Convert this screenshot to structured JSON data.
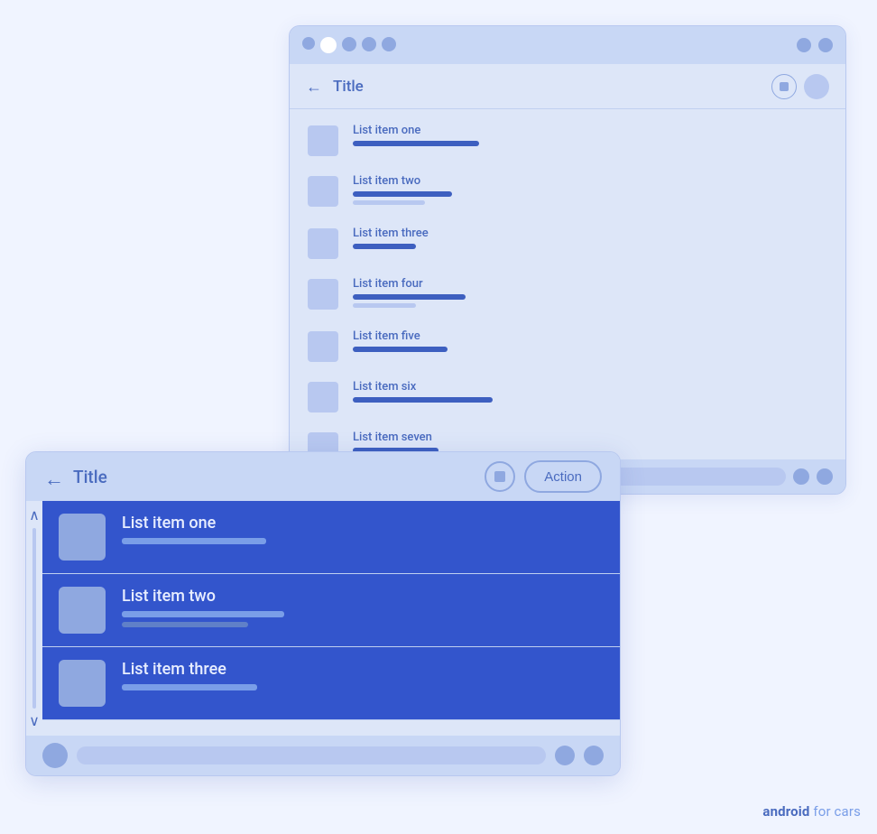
{
  "back_window": {
    "title": "Title",
    "list_items": [
      {
        "label": "List item one",
        "bar1_w": 140,
        "bar2_w": 0,
        "bar3_w": 0
      },
      {
        "label": "List item two",
        "bar1_w": 110,
        "bar2_w": 80,
        "bar3_w": 0
      },
      {
        "label": "List item three",
        "bar1_w": 70,
        "bar2_w": 0,
        "bar3_w": 0
      },
      {
        "label": "List item four",
        "bar1_w": 125,
        "bar2_w": 70,
        "bar3_w": 0
      },
      {
        "label": "List item five",
        "bar1_w": 105,
        "bar2_w": 0,
        "bar3_w": 0
      },
      {
        "label": "List item six",
        "bar1_w": 155,
        "bar2_w": 0,
        "bar3_w": 0
      },
      {
        "label": "List item seven",
        "bar1_w": 95,
        "bar2_w": 0,
        "bar3_w": 0
      }
    ]
  },
  "front_window": {
    "title": "Title",
    "action_label": "Action",
    "list_items": [
      {
        "label": "List item one",
        "bar1_w": 160,
        "bar2_w": 0
      },
      {
        "label": "List item two",
        "bar1_w": 180,
        "bar2_w": 140
      },
      {
        "label": "List item three",
        "bar1_w": 150,
        "bar2_w": 0
      }
    ]
  },
  "watermark": {
    "prefix": "android",
    "suffix": " for cars"
  }
}
